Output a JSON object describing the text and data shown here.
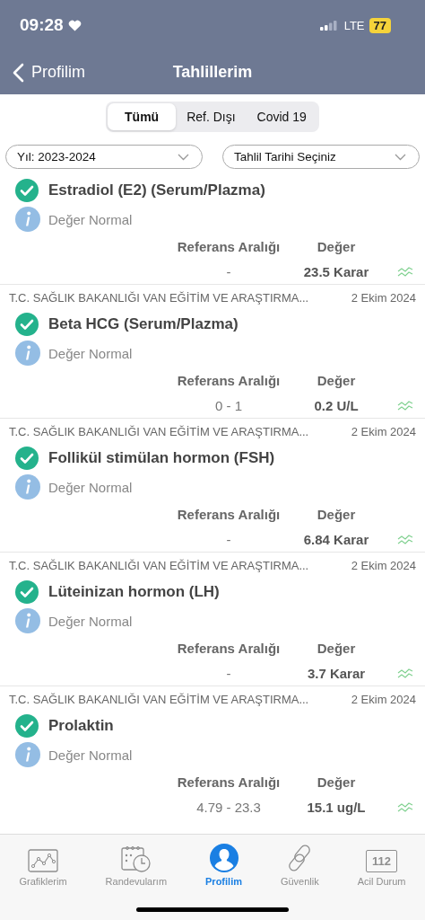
{
  "status_bar": {
    "time": "09:28",
    "network": "LTE",
    "battery": "77"
  },
  "nav": {
    "back": "Profilim",
    "title": "Tahlillerim"
  },
  "segments": [
    {
      "label": "Tümü",
      "selected": true
    },
    {
      "label": "Ref. Dışı",
      "selected": false
    },
    {
      "label": "Covid 19",
      "selected": false
    }
  ],
  "filters": [
    {
      "value": "Yıl: 2023-2024"
    },
    {
      "value": "Tahlil Tarihi Seçiniz"
    }
  ],
  "results": [
    {
      "name": "Estradiol (E2) (Serum/Plazma)",
      "status": "Değer Normal",
      "reference_label": "Referans Aralığı",
      "value_label": "Değer",
      "reference": "-",
      "value": "23.5 Karar"
    },
    {
      "source": "T.C. SAĞLIK BAKANLIĞI VAN EĞİTİM VE ARAŞTIRMA...",
      "date": "2 Ekim 2024",
      "name": "Beta HCG (Serum/Plazma)",
      "status": "Değer Normal",
      "reference_label": "Referans Aralığı",
      "value_label": "Değer",
      "reference": "0 - 1",
      "value": "0.2 U/L"
    },
    {
      "source": "T.C. SAĞLIK BAKANLIĞI VAN EĞİTİM VE ARAŞTIRMA...",
      "date": "2 Ekim 2024",
      "name": "Follikül stimülan hormon (FSH)",
      "status": "Değer Normal",
      "reference_label": "Referans Aralığı",
      "value_label": "Değer",
      "reference": "-",
      "value": "6.84 Karar"
    },
    {
      "source": "T.C. SAĞLIK BAKANLIĞI VAN EĞİTİM VE ARAŞTIRMA...",
      "date": "2 Ekim 2024",
      "name": "Lüteinizan hormon (LH)",
      "status": "Değer Normal",
      "reference_label": "Referans Aralığı",
      "value_label": "Değer",
      "reference": "-",
      "value": "3.7 Karar"
    },
    {
      "source": "T.C. SAĞLIK BAKANLIĞI VAN EĞİTİM VE ARAŞTIRMA...",
      "date": "2 Ekim 2024",
      "name": "Prolaktin",
      "status": "Değer Normal",
      "reference_label": "Referans Aralığı",
      "value_label": "Değer",
      "reference": "4.79 - 23.3",
      "value": "15.1 ug/L"
    }
  ],
  "tab_bar": [
    {
      "kind": "chart",
      "label": "Grafiklerim",
      "selected": false
    },
    {
      "kind": "calendar",
      "label": "Randevularım",
      "selected": false
    },
    {
      "kind": "profile",
      "label": "Profilim",
      "selected": true
    },
    {
      "kind": "link",
      "label": "Güvenlik",
      "selected": false
    },
    {
      "kind": "emergency",
      "label": "Acil Durum",
      "badge": "112",
      "selected": false
    }
  ]
}
